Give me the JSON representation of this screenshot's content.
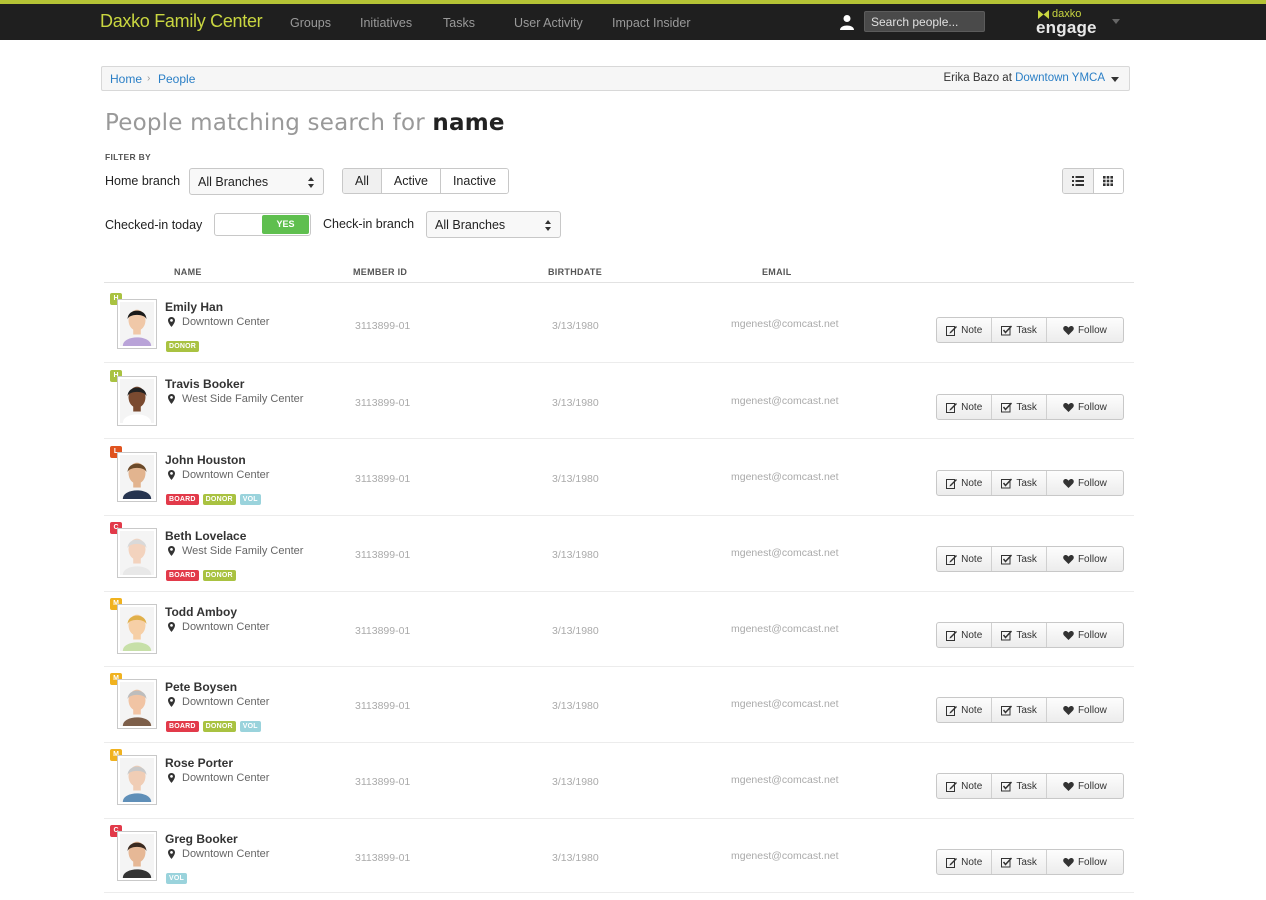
{
  "nav": {
    "brand": "Daxko Family Center",
    "links": [
      "Groups",
      "Initiatives",
      "Tasks",
      "User Activity",
      "Impact Insider"
    ],
    "search_placeholder": "Search people...",
    "logo_top": "daxko",
    "logo_bottom": "engage"
  },
  "breadcrumb": {
    "home": "Home",
    "sep": "›",
    "current": "People",
    "user_name": "Erika Bazo",
    "at": "at",
    "location": "Downtown YMCA"
  },
  "title": {
    "prefix": "People matching search for",
    "query": "name"
  },
  "filters": {
    "filter_by": "FILTER BY",
    "home_branch_label": "Home branch",
    "home_branch_value": "All Branches",
    "status_options": [
      "All",
      "Active",
      "Inactive"
    ],
    "checked_in_label": "Checked-in today",
    "toggle_value": "YES",
    "checkin_branch_label": "Check-in branch",
    "checkin_branch_value": "All Branches"
  },
  "table": {
    "headers": {
      "name": "NAME",
      "member_id": "MEMBER ID",
      "birthdate": "BIRTHDATE",
      "email": "EMAIL"
    },
    "actions": {
      "note": "Note",
      "task": "Task",
      "follow": "Follow"
    },
    "tier_colors": {
      "H": "#a9c241",
      "L": "#e0531f",
      "C": "#e23a4a",
      "M": "#f0b21f"
    },
    "rows": [
      {
        "tier": "H",
        "name": "Emily Han",
        "location": "Downtown Center",
        "tags": [
          "DONOR"
        ],
        "member_id": "3113899-01",
        "birthdate": "3/13/1980",
        "email": "mgenest@comcast.net"
      },
      {
        "tier": "H",
        "name": "Travis Booker",
        "location": "West Side Family Center",
        "tags": [],
        "member_id": "3113899-01",
        "birthdate": "3/13/1980",
        "email": "mgenest@comcast.net"
      },
      {
        "tier": "L",
        "name": "John Houston",
        "location": "Downtown Center",
        "tags": [
          "BOARD",
          "DONOR",
          "VOL"
        ],
        "member_id": "3113899-01",
        "birthdate": "3/13/1980",
        "email": "mgenest@comcast.net"
      },
      {
        "tier": "C",
        "name": "Beth Lovelace",
        "location": "West Side Family Center",
        "tags": [
          "BOARD",
          "DONOR"
        ],
        "member_id": "3113899-01",
        "birthdate": "3/13/1980",
        "email": "mgenest@comcast.net"
      },
      {
        "tier": "M",
        "name": "Todd Amboy",
        "location": "Downtown Center",
        "tags": [],
        "member_id": "3113899-01",
        "birthdate": "3/13/1980",
        "email": "mgenest@comcast.net"
      },
      {
        "tier": "M",
        "name": "Pete Boysen",
        "location": "Downtown Center",
        "tags": [
          "BOARD",
          "DONOR",
          "VOL"
        ],
        "member_id": "3113899-01",
        "birthdate": "3/13/1980",
        "email": "mgenest@comcast.net"
      },
      {
        "tier": "M",
        "name": "Rose Porter",
        "location": "Downtown Center",
        "tags": [],
        "member_id": "3113899-01",
        "birthdate": "3/13/1980",
        "email": "mgenest@comcast.net"
      },
      {
        "tier": "C",
        "name": "Greg Booker",
        "location": "Downtown Center",
        "tags": [
          "VOL"
        ],
        "member_id": "3113899-01",
        "birthdate": "3/13/1980",
        "email": "mgenest@comcast.net"
      }
    ]
  }
}
